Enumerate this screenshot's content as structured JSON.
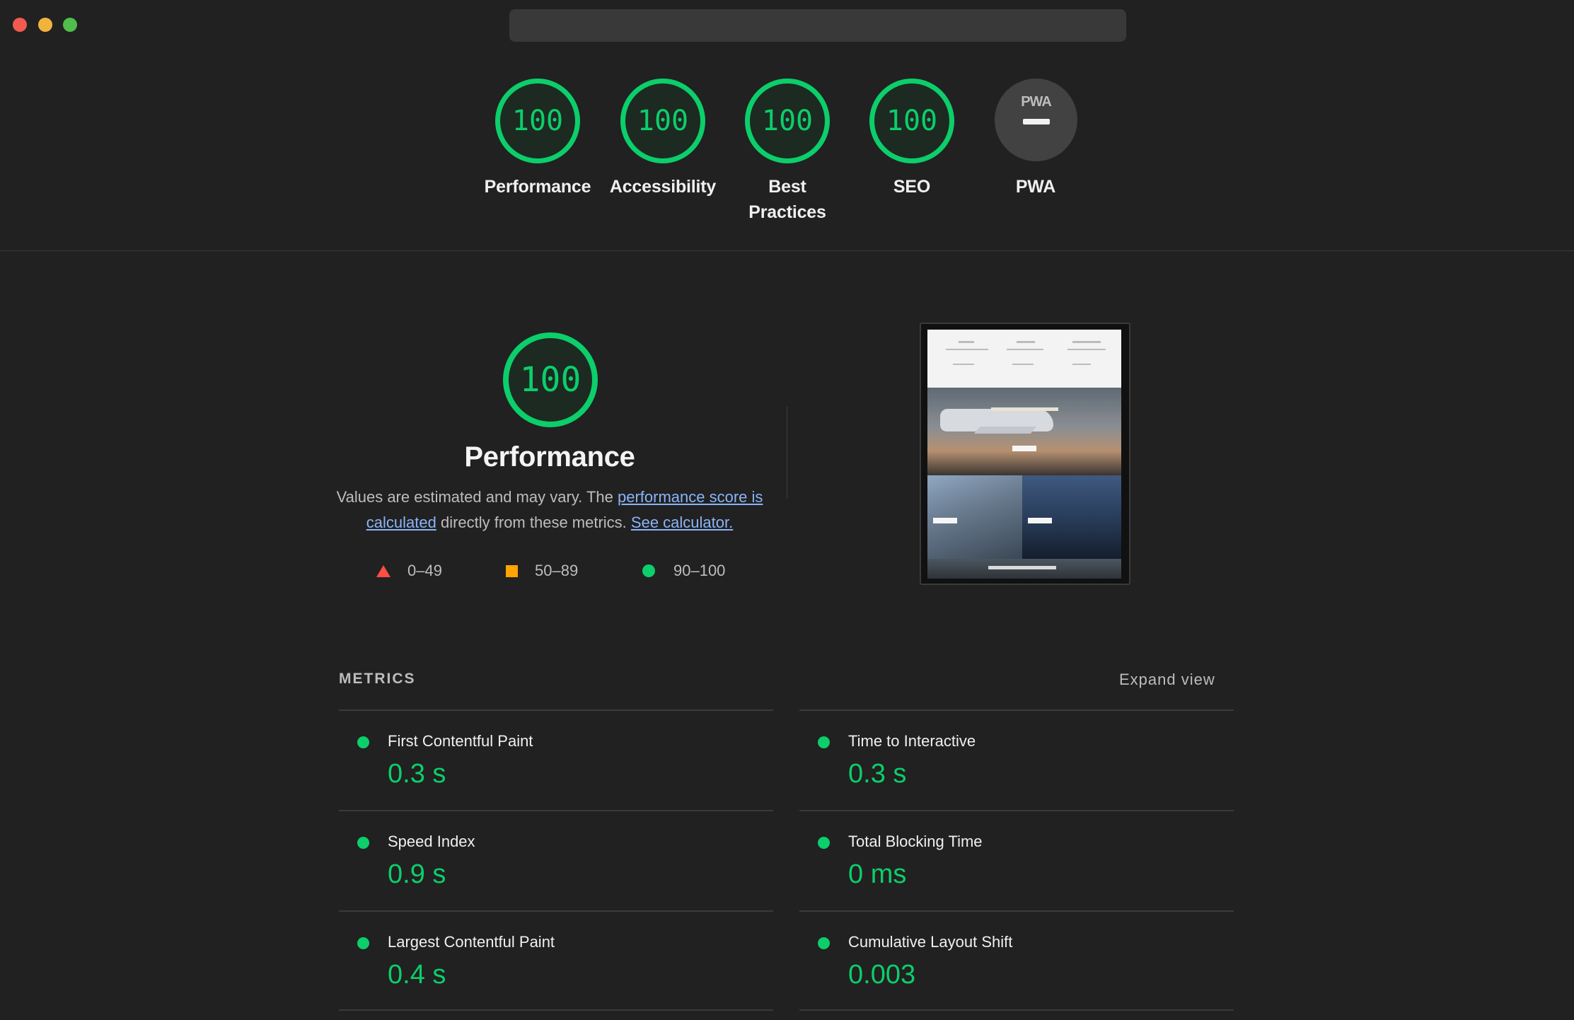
{
  "window": {
    "controls": [
      "close",
      "minimize",
      "zoom"
    ],
    "url": ""
  },
  "categories": [
    {
      "label": "Performance",
      "score": "100"
    },
    {
      "label": "Accessibility",
      "score": "100"
    },
    {
      "label_line1": "Best",
      "label_line2": "Practices",
      "score": "100"
    },
    {
      "label": "SEO",
      "score": "100"
    },
    {
      "label": "PWA",
      "badge": "PWA"
    }
  ],
  "performance": {
    "score": "100",
    "title": "Performance",
    "desc_before": "Values are estimated and may vary. The ",
    "link_score": "performance score is calculated",
    "desc_middle": " directly from these metrics. ",
    "link_calc": "See calculator.",
    "legend": [
      {
        "range": "0–49",
        "color": "#ff4e42"
      },
      {
        "range": "50–89",
        "color": "#ffa400"
      },
      {
        "range": "90–100",
        "color": "#0cce6b"
      }
    ]
  },
  "metrics": {
    "heading": "METRICS",
    "expand_label": "Expand view",
    "items": [
      {
        "title": "First Contentful Paint",
        "value": "0.3 s"
      },
      {
        "title": "Time to Interactive",
        "value": "0.3 s"
      },
      {
        "title": "Speed Index",
        "value": "0.9 s"
      },
      {
        "title": "Total Blocking Time",
        "value": "0 ms"
      },
      {
        "title": "Largest Contentful Paint",
        "value": "0.4 s"
      },
      {
        "title": "Cumulative Layout Shift",
        "value": "0.003"
      }
    ]
  },
  "colors": {
    "pass": "#0cce6b",
    "average": "#ffa400",
    "fail": "#ff4e42",
    "background": "#212121",
    "link": "#8ab4f8"
  }
}
